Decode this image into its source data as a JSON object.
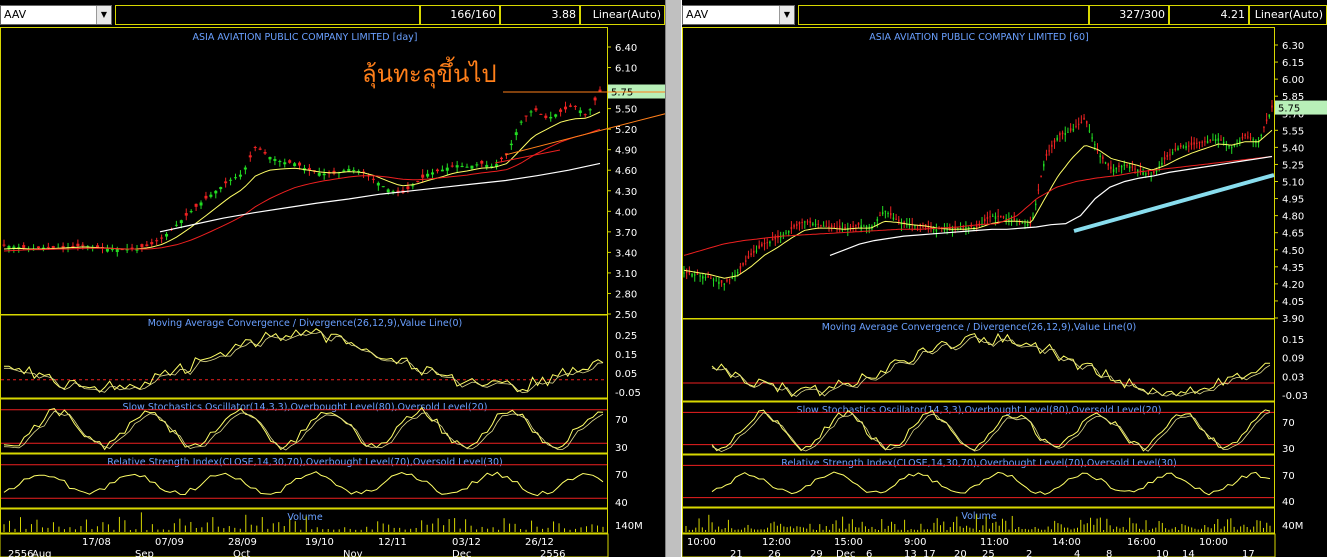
{
  "colors": {
    "bg": "#000000",
    "frame": "#d7d700",
    "title": "#6aa0ff",
    "price_up": "#22dd22",
    "price_down": "#ee2222",
    "ma_fast": "#ffff66",
    "ma_mid": "#ee2020",
    "ma_slow": "#ffffff",
    "trend_cyan": "#88ddee",
    "annotation": "#ff7f1a",
    "last_price_bg": "#b8f0b8"
  },
  "left": {
    "symbol": "AAV",
    "bars": "166/160",
    "value": "3.88",
    "scale": "Linear(Auto)",
    "title": "ASIA AVIATION PUBLIC COMPANY LIMITED [day]",
    "annotation": "ลุ้นทะลุขึ้นไป",
    "last_price": "5.75",
    "price_ticks": [
      "6.40",
      "6.10",
      "5.80",
      "5.50",
      "5.20",
      "4.90",
      "4.60",
      "4.30",
      "4.00",
      "3.70",
      "3.40",
      "3.10",
      "2.80",
      "2.50"
    ],
    "macd_title": "Moving Average Convergence / Divergence(26,12,9),Value Line(0)",
    "macd_ticks": [
      "0.25",
      "0.15",
      "0.05",
      "-0.05"
    ],
    "stoch_title": "Slow Stochastics Oscillator(14,3,3),Overbought Level(80),Oversold Level(20)",
    "stoch_ticks": [
      "70",
      "30"
    ],
    "rsi_title": "Relative Strength Index(CLOSE,14,30,70),Overbought Level(70),Oversold Level(30)",
    "rsi_ticks": [
      "70",
      "40"
    ],
    "volume_title": "Volume",
    "volume_tick": "140M",
    "date_row1": [
      "17/08",
      "07/09",
      "28/09",
      "19/10",
      "12/11",
      "03/12",
      "26/12"
    ],
    "date_row2": [
      "2556",
      "Aug",
      "Sep",
      "Oct",
      "Nov",
      "Dec",
      "2556"
    ]
  },
  "right": {
    "symbol": "AAV",
    "bars": "327/300",
    "value": "4.21",
    "scale": "Linear(Auto)",
    "title": "ASIA AVIATION PUBLIC COMPANY LIMITED [60]",
    "last_price": "5.75",
    "price_ticks": [
      "6.30",
      "6.15",
      "6.00",
      "5.85",
      "5.70",
      "5.55",
      "5.40",
      "5.25",
      "5.10",
      "4.95",
      "4.80",
      "4.65",
      "4.50",
      "4.35",
      "4.20",
      "4.05",
      "3.90"
    ],
    "macd_title": "Moving Average Convergence / Divergence(26,12,9),Value Line(0)",
    "macd_ticks": [
      "0.15",
      "0.09",
      "0.03",
      "-0.03"
    ],
    "stoch_title": "Slow Stochastics Oscillator(14,3,3),Overbought Level(80),Oversold Level(20)",
    "stoch_ticks": [
      "70",
      "30"
    ],
    "rsi_title": "Relative Strength Index(CLOSE,14,30,70),Overbought Level(70),Oversold Level(30)",
    "rsi_ticks": [
      "70",
      "40"
    ],
    "volume_title": "Volume",
    "volume_tick": "40M",
    "time_row1": [
      "10:00",
      "12:00",
      "15:00",
      "9:00",
      "11:00",
      "14:00",
      "16:00",
      "10:00"
    ],
    "time_row2": [
      "21",
      "26",
      "29",
      "Dec",
      "6",
      "13",
      "17",
      "20",
      "25",
      "2",
      "4",
      "8",
      "10",
      "14",
      "17"
    ]
  },
  "chart_data": [
    {
      "type": "line",
      "title": "ASIA AVIATION PUBLIC COMPANY LIMITED [day]",
      "ylim": [
        2.5,
        6.4
      ],
      "series": [
        {
          "values": [
            3.5,
            3.48,
            3.45,
            3.47,
            3.46,
            3.48,
            3.5,
            3.47,
            3.45,
            3.44,
            3.46,
            3.5,
            3.62,
            3.8,
            3.98,
            4.15,
            4.3,
            4.45,
            4.55,
            4.95,
            4.8,
            4.72,
            4.7,
            4.6,
            4.55,
            4.55,
            4.62,
            4.58,
            4.45,
            4.32,
            4.25,
            4.4,
            4.55,
            4.6,
            4.68,
            4.65,
            4.7,
            4.65,
            4.85,
            5.3,
            5.5,
            5.35,
            5.45,
            5.55,
            5.4,
            5.75
          ]
        },
        {
          "values": [
            3.45,
            3.46,
            3.45,
            3.45,
            3.46,
            3.47,
            3.48,
            3.47,
            3.46,
            3.45,
            3.45,
            3.47,
            3.52,
            3.62,
            3.75,
            3.9,
            4.05,
            4.2,
            4.32,
            4.52,
            4.6,
            4.62,
            4.63,
            4.6,
            4.57,
            4.56,
            4.58,
            4.57,
            4.52,
            4.44,
            4.37,
            4.39,
            4.45,
            4.5,
            4.56,
            4.59,
            4.63,
            4.64,
            4.7,
            4.9,
            5.1,
            5.2,
            5.3,
            5.35,
            5.36,
            5.45
          ]
        },
        {
          "values": [
            3.42,
            3.43,
            3.44,
            3.44,
            3.45,
            3.45,
            3.46,
            3.46,
            3.46,
            3.45,
            3.45,
            3.45,
            3.47,
            3.51,
            3.57,
            3.65,
            3.74,
            3.83,
            3.93,
            4.07,
            4.18,
            4.27,
            4.35,
            4.4,
            4.44,
            4.47,
            4.5,
            4.52,
            4.52,
            4.5,
            4.47,
            4.46,
            4.47,
            4.49,
            4.51,
            4.53,
            4.56,
            4.58,
            4.61,
            4.7,
            4.82,
            4.92,
            5.01,
            5.08,
            5.13,
            5.2
          ]
        },
        {
          "values": [
            3.7,
            3.8,
            3.9,
            3.98,
            4.05,
            4.12,
            4.18,
            4.25,
            4.3,
            4.35,
            4.4,
            4.45,
            4.52,
            4.6,
            4.7
          ]
        }
      ]
    },
    {
      "type": "line",
      "title": "ASIA AVIATION PUBLIC COMPANY LIMITED [60]",
      "ylim": [
        3.9,
        6.3
      ],
      "series": [
        {
          "values": [
            4.3,
            4.28,
            4.25,
            4.2,
            4.3,
            4.45,
            4.55,
            4.6,
            4.68,
            4.75,
            4.72,
            4.7,
            4.68,
            4.72,
            4.7,
            4.85,
            4.75,
            4.72,
            4.7,
            4.68,
            4.68,
            4.7,
            4.7,
            4.8,
            4.78,
            4.75,
            4.72,
            5.3,
            5.5,
            5.55,
            5.65,
            5.35,
            5.2,
            5.25,
            5.2,
            5.15,
            5.3,
            5.4,
            5.42,
            5.45,
            5.48,
            5.4,
            5.5,
            5.45,
            5.75
          ]
        },
        {
          "values": [
            4.32,
            4.3,
            4.28,
            4.25,
            4.27,
            4.35,
            4.45,
            4.52,
            4.6,
            4.67,
            4.69,
            4.69,
            4.68,
            4.69,
            4.69,
            4.75,
            4.74,
            4.72,
            4.71,
            4.69,
            4.68,
            4.68,
            4.69,
            4.73,
            4.75,
            4.75,
            4.74,
            4.95,
            5.15,
            5.3,
            5.42,
            5.38,
            5.3,
            5.27,
            5.24,
            5.2,
            5.24,
            5.3,
            5.35,
            5.39,
            5.43,
            5.42,
            5.45,
            5.45,
            5.55
          ]
        },
        {
          "values": [
            4.45,
            4.5,
            4.55,
            4.58,
            4.6,
            4.62,
            4.63,
            4.64,
            4.65,
            4.66,
            4.67,
            4.68,
            4.68,
            4.69,
            4.7,
            4.72,
            4.73,
            4.8,
            4.95,
            5.05,
            5.1,
            5.13,
            5.15,
            5.18,
            5.2,
            5.22,
            5.24,
            5.26,
            5.28,
            5.3,
            5.32
          ]
        }
      ]
    }
  ]
}
